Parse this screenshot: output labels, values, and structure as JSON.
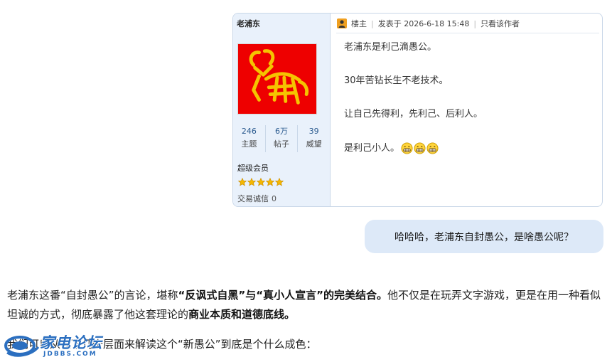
{
  "post": {
    "username": "老浦东",
    "stats": [
      {
        "value": "246",
        "label": "主题"
      },
      {
        "value": "6万",
        "label": "帖子"
      },
      {
        "value": "39",
        "label": "威望"
      }
    ],
    "rank": "超级会员",
    "star_count": 5,
    "credit_label": "交易诚信",
    "credit_value": "0",
    "header": {
      "floor": "楼主",
      "posted_at": "发表于 2026-6-18 15:48",
      "only_author": "只看该作者"
    },
    "body": {
      "line1": "老浦东是利己滴愚公。",
      "line2": "30年苦钻长生不老技术。",
      "line3": "让自己先得利，先利己、后利人。",
      "line4": "是利己小人。"
    },
    "emoji_names": [
      "grin-emoji",
      "grin-emoji",
      "grin-emoji"
    ],
    "colors": {
      "avatar_bg": "#ee0000",
      "avatar_figure": "#f5c400",
      "profile_bg": "#e9f1fb"
    }
  },
  "chat": {
    "bubble_text": "哈哈哈，老浦东自封愚公，是啥愚公呢？",
    "bubble_color": "#dde9f8"
  },
  "article": {
    "p1_a": "老浦东这番“自封愚公”的言论，堪称",
    "p1_b": "“反讽式自黑”与“真小人宣言”的完美结合。",
    "p1_c": "他不仅是在玩弄文字游戏，更是在用一种看似坦诚的方式，彻底暴露了他这套理论的",
    "p1_d": "商业本质和道德底线。",
    "p2": "我们可以从以下几个层面来解读这个“新愚公”到底是个什么成色："
  },
  "watermark": {
    "title": "家电论坛",
    "subtitle": "JDBBS.COM"
  }
}
